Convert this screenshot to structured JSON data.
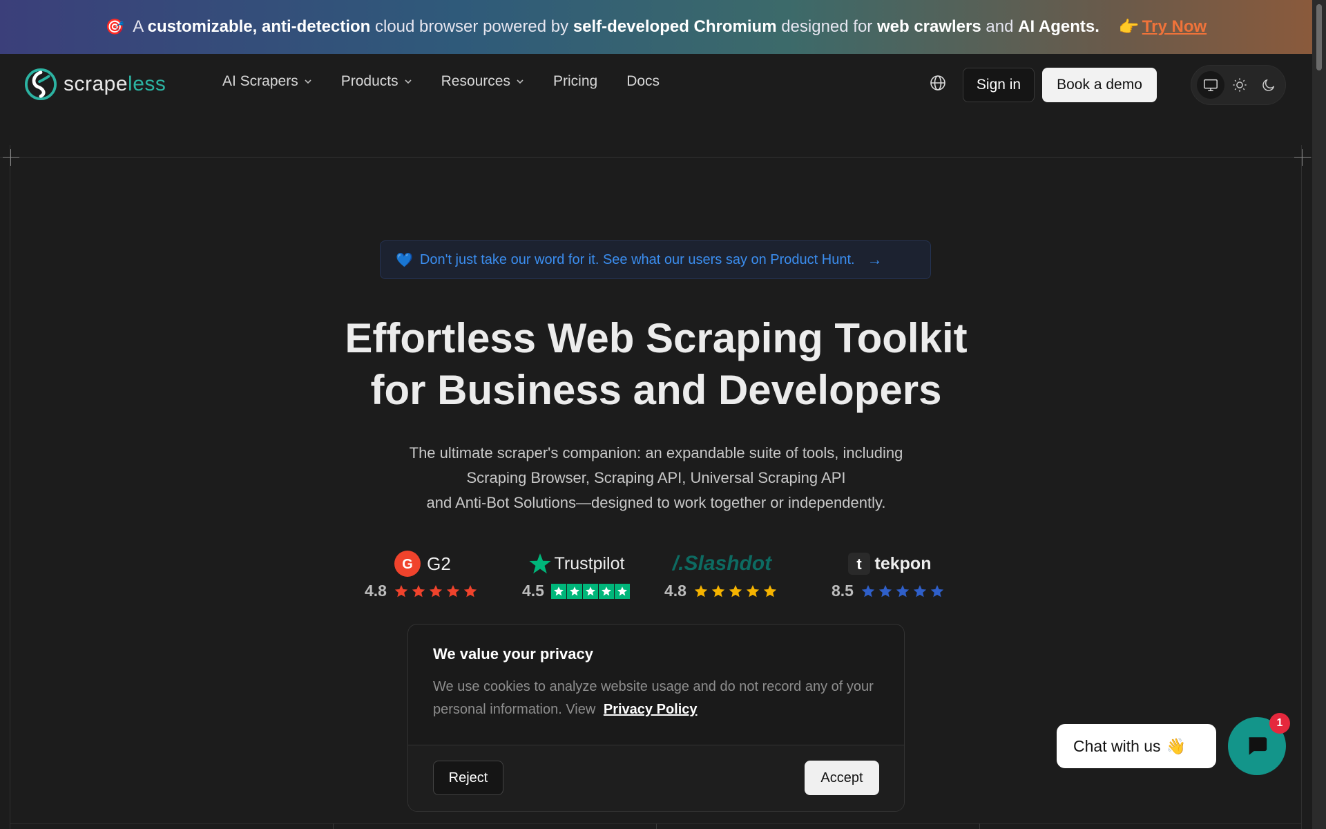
{
  "promo": {
    "segments": [
      {
        "text": "A ",
        "bold": false
      },
      {
        "text": "customizable, anti-detection",
        "bold": true
      },
      {
        "text": " cloud browser powered by ",
        "bold": false
      },
      {
        "text": "self-developed Chromium",
        "bold": true
      },
      {
        "text": " designed for ",
        "bold": false
      },
      {
        "text": "web crawlers",
        "bold": true
      },
      {
        "text": " and ",
        "bold": false
      },
      {
        "text": "AI Agents.",
        "bold": true
      }
    ],
    "cta_label": "Try Now",
    "icon": "target-emoji",
    "cta_icon": "pointing-hand-emoji"
  },
  "nav": {
    "logo_text_a": "scrape",
    "logo_text_b": "less",
    "menu": [
      {
        "label": "AI Scrapers",
        "has_dropdown": true
      },
      {
        "label": "Products",
        "has_dropdown": true
      },
      {
        "label": "Resources",
        "has_dropdown": true
      },
      {
        "label": "Pricing",
        "has_dropdown": false
      },
      {
        "label": "Docs",
        "has_dropdown": false
      }
    ],
    "signin_label": "Sign in",
    "demo_label": "Book a demo",
    "theme_options": [
      "monitor-icon",
      "sun-icon",
      "moon-icon"
    ],
    "theme_selected": "monitor-icon"
  },
  "hero": {
    "pill_text": "Don't just take our word for it. See what our users say on Product Hunt.",
    "title_line1": "Effortless Web Scraping Toolkit",
    "title_line2": "for Business and Developers",
    "subtitle_line1": "The ultimate scraper's companion: an expandable suite of tools, including",
    "subtitle_line2": "Scraping Browser, Scraping API, Universal Scraping API",
    "subtitle_line3": "and Anti-Bot Solutions—designed to work together or independently."
  },
  "ratings": [
    {
      "brand": "G2",
      "score": "4.8",
      "color": "#f0432c"
    },
    {
      "brand": "Trustpilot",
      "score": "4.5",
      "color": "#00b67a"
    },
    {
      "brand": "Slashdot",
      "score": "4.8",
      "color": "#f6b400"
    },
    {
      "brand": "tekpon",
      "score": "8.5",
      "color": "#2f5fc9"
    }
  ],
  "cookie": {
    "title": "We value your privacy",
    "text": "We use cookies to analyze website usage and do not record any of your personal information. View",
    "link_label": "Privacy Policy",
    "reject_label": "Reject",
    "accept_label": "Accept"
  },
  "chat": {
    "bubble_text": "Chat with us",
    "badge_count": "1"
  },
  "colors": {
    "brand_teal": "#2cb3a2",
    "cta_orange": "#f0733a",
    "chat_teal": "#13958a",
    "link_blue": "#3b8ef0"
  }
}
